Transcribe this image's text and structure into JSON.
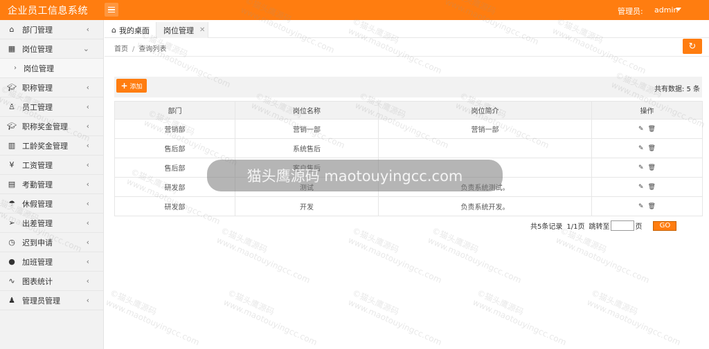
{
  "app": {
    "title": "企业员工信息系统"
  },
  "header": {
    "admin_label": "管理员:",
    "admin_user": "admin"
  },
  "sidebar": {
    "items": [
      {
        "label": "部门管理",
        "icon": "home-icon"
      },
      {
        "label": "岗位管理",
        "icon": "org-icon",
        "expanded": true
      },
      {
        "label": "岗位管理",
        "sub": true
      },
      {
        "label": "职称管理",
        "icon": "graduation-cap-icon"
      },
      {
        "label": "员工管理",
        "icon": "user-icon"
      },
      {
        "label": "职称奖金管理",
        "icon": "graduation-cap-icon"
      },
      {
        "label": "工龄奖金管理",
        "icon": "book-icon"
      },
      {
        "label": "工资管理",
        "icon": "yen-icon"
      },
      {
        "label": "考勤管理",
        "icon": "calendar-icon"
      },
      {
        "label": "休假管理",
        "icon": "palm-tree-icon"
      },
      {
        "label": "出差管理",
        "icon": "paper-plane-icon"
      },
      {
        "label": "迟到申请",
        "icon": "clock-icon"
      },
      {
        "label": "加班管理",
        "icon": "circle-icon"
      },
      {
        "label": "图表统计",
        "icon": "pulse-icon"
      },
      {
        "label": "管理员管理",
        "icon": "admin-user-icon"
      }
    ]
  },
  "tabs": {
    "home": "我的桌面",
    "active": "岗位管理"
  },
  "breadcrumb": {
    "home": "首页",
    "separator": "/",
    "current": "查询列表"
  },
  "toolbar": {
    "add_label": "添加",
    "total_label": "共有数据:",
    "total_count": "5",
    "total_unit": "条"
  },
  "table": {
    "headers": [
      "部门",
      "岗位名称",
      "岗位简介",
      "操作"
    ],
    "rows": [
      {
        "dept": "营销部",
        "name": "营销一部",
        "desc": "营销一部"
      },
      {
        "dept": "售后部",
        "name": "系统售后",
        "desc": ""
      },
      {
        "dept": "售后部",
        "name": "客户售后",
        "desc": ""
      },
      {
        "dept": "研发部",
        "name": "测试",
        "desc": "负责系统测试。"
      },
      {
        "dept": "研发部",
        "name": "开发",
        "desc": "负责系统开发。"
      }
    ]
  },
  "pager": {
    "records": "共5条记录",
    "pages": "1/1页",
    "goto_label": "跳转至",
    "page_unit": "页",
    "go_label": "GO"
  },
  "watermark": {
    "text_1": "©猫头鹰源码",
    "text_2": "www.maotouyingcc.com",
    "banner": "猫头鹰源码 maotouyingcc.com"
  },
  "colors": {
    "accent": "#ff7d10"
  }
}
